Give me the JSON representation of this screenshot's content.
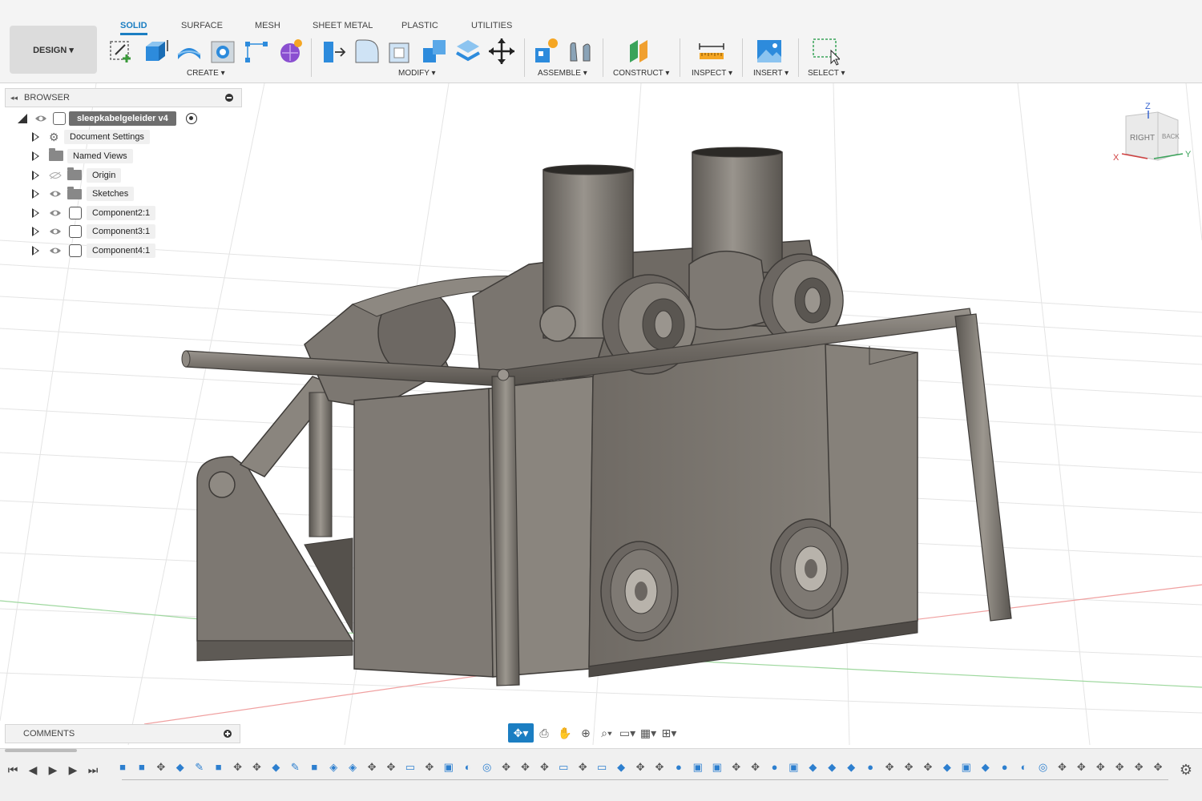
{
  "toolbar": {
    "workspace": "DESIGN ▾",
    "tabs": [
      "SOLID",
      "SURFACE",
      "MESH",
      "SHEET METAL",
      "PLASTIC",
      "UTILITIES"
    ],
    "active_tab": "SOLID",
    "groups": {
      "create": "CREATE ▾",
      "modify": "MODIFY ▾",
      "assemble": "ASSEMBLE ▾",
      "construct": "CONSTRUCT ▾",
      "inspect": "INSPECT ▾",
      "insert": "INSERT ▾",
      "select": "SELECT ▾"
    },
    "accent_color": "#1b7ec2"
  },
  "browser": {
    "title": "BROWSER",
    "root": "sleepkabelgeleider v4",
    "items": [
      {
        "label": "Document Settings",
        "icon": "gear-icon"
      },
      {
        "label": "Named Views",
        "icon": "folder-icon"
      },
      {
        "label": "Origin",
        "icon": "folder-icon",
        "hidden": true
      },
      {
        "label": "Sketches",
        "icon": "folder-icon"
      },
      {
        "label": "Component2:1",
        "icon": "component-icon"
      },
      {
        "label": "Component3:1",
        "icon": "component-icon"
      },
      {
        "label": "Component4:1",
        "icon": "component-icon"
      }
    ]
  },
  "viewcube": {
    "face_right": "RIGHT",
    "face_back": "BACK",
    "axis_z": "Z",
    "axis_x": "X",
    "axis_y": "Y"
  },
  "comments": {
    "title": "COMMENTS"
  },
  "navbar": {
    "icons": [
      "orbit-icon",
      "look-at-icon",
      "pan-icon",
      "zoom-icon",
      "fit-icon",
      "display-settings-icon",
      "grid-icon",
      "viewports-icon"
    ]
  },
  "timeline": {
    "controls": [
      "first-icon",
      "previous-icon",
      "play-icon",
      "next-icon",
      "last-icon"
    ],
    "feature_count": 55
  }
}
